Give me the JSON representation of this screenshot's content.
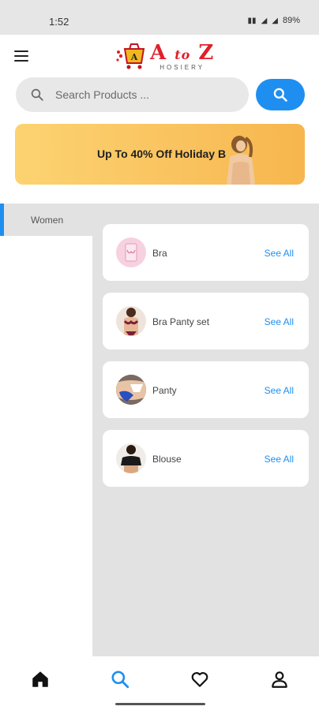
{
  "status_bar": {
    "time": "1:52",
    "battery": "89%"
  },
  "header": {
    "brand_main": "A",
    "brand_to": "to",
    "brand_z": "Z",
    "brand_sub": "HOSIERY"
  },
  "search": {
    "placeholder": "Search Products ..."
  },
  "banner": {
    "text": "Up To 40% Off Holiday B"
  },
  "sidebar": {
    "items": [
      {
        "label": "Women",
        "selected": true
      }
    ]
  },
  "categories": [
    {
      "name": "Bra",
      "action": "See All",
      "icon": "bra-thumbnail"
    },
    {
      "name": "Bra Panty set",
      "action": "See All",
      "icon": "bra-panty-set-thumbnail"
    },
    {
      "name": "Panty",
      "action": "See All",
      "icon": "panty-thumbnail"
    },
    {
      "name": "Blouse",
      "action": "See All",
      "icon": "blouse-thumbnail"
    }
  ],
  "bottom_nav": [
    {
      "icon": "home-icon",
      "active": false
    },
    {
      "icon": "search-icon",
      "active": true
    },
    {
      "icon": "heart-icon",
      "active": false
    },
    {
      "icon": "profile-icon",
      "active": false
    }
  ],
  "colors": {
    "accent": "#1e8ff0",
    "brand_red": "#e0202a",
    "banner": "#fcd371",
    "background": "#e2e2e2"
  }
}
